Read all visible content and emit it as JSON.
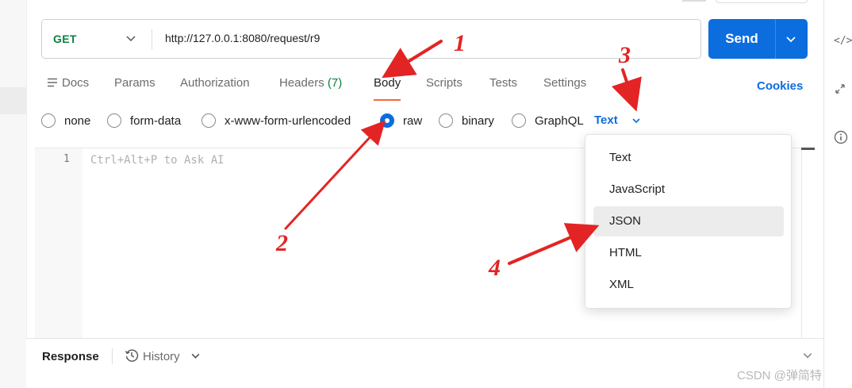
{
  "request": {
    "method": "GET",
    "url": "http://127.0.0.1:8080/request/r9",
    "send_label": "Send"
  },
  "tabs": [
    {
      "label": "Docs"
    },
    {
      "label": "Params"
    },
    {
      "label": "Authorization"
    },
    {
      "label": "Headers",
      "count": "(7)"
    },
    {
      "label": "Body",
      "active": true
    },
    {
      "label": "Scripts"
    },
    {
      "label": "Tests"
    },
    {
      "label": "Settings"
    }
  ],
  "cookies_label": "Cookies",
  "body_types": [
    {
      "label": "none"
    },
    {
      "label": "form-data"
    },
    {
      "label": "x-www-form-urlencoded"
    },
    {
      "label": "raw",
      "checked": true
    },
    {
      "label": "binary"
    },
    {
      "label": "GraphQL"
    }
  ],
  "raw_language": "Text",
  "editor": {
    "line_number": "1",
    "placeholder": "Ctrl+Alt+P to Ask AI"
  },
  "language_options": [
    {
      "label": "Text"
    },
    {
      "label": "JavaScript"
    },
    {
      "label": "JSON",
      "highlighted": true
    },
    {
      "label": "HTML"
    },
    {
      "label": "XML"
    }
  ],
  "response": {
    "label": "Response",
    "history_label": "History"
  },
  "watermark": "CSDN @弹简特",
  "annotations": {
    "n1": "1",
    "n2": "2",
    "n3": "3",
    "n4": "4"
  },
  "colors": {
    "accent": "#0c6ddf",
    "method_green": "#0a7f3f",
    "tab_underline": "#f26b3a",
    "annotation_red": "#e32424"
  },
  "icons": {
    "method_dropdown": "chevron-down-icon",
    "send_dropdown": "chevron-down-icon",
    "docs": "lines-icon",
    "history": "clock-history-icon",
    "side_code": "code-icon",
    "side_expand": "expand-arrows-icon",
    "side_info": "info-icon"
  }
}
